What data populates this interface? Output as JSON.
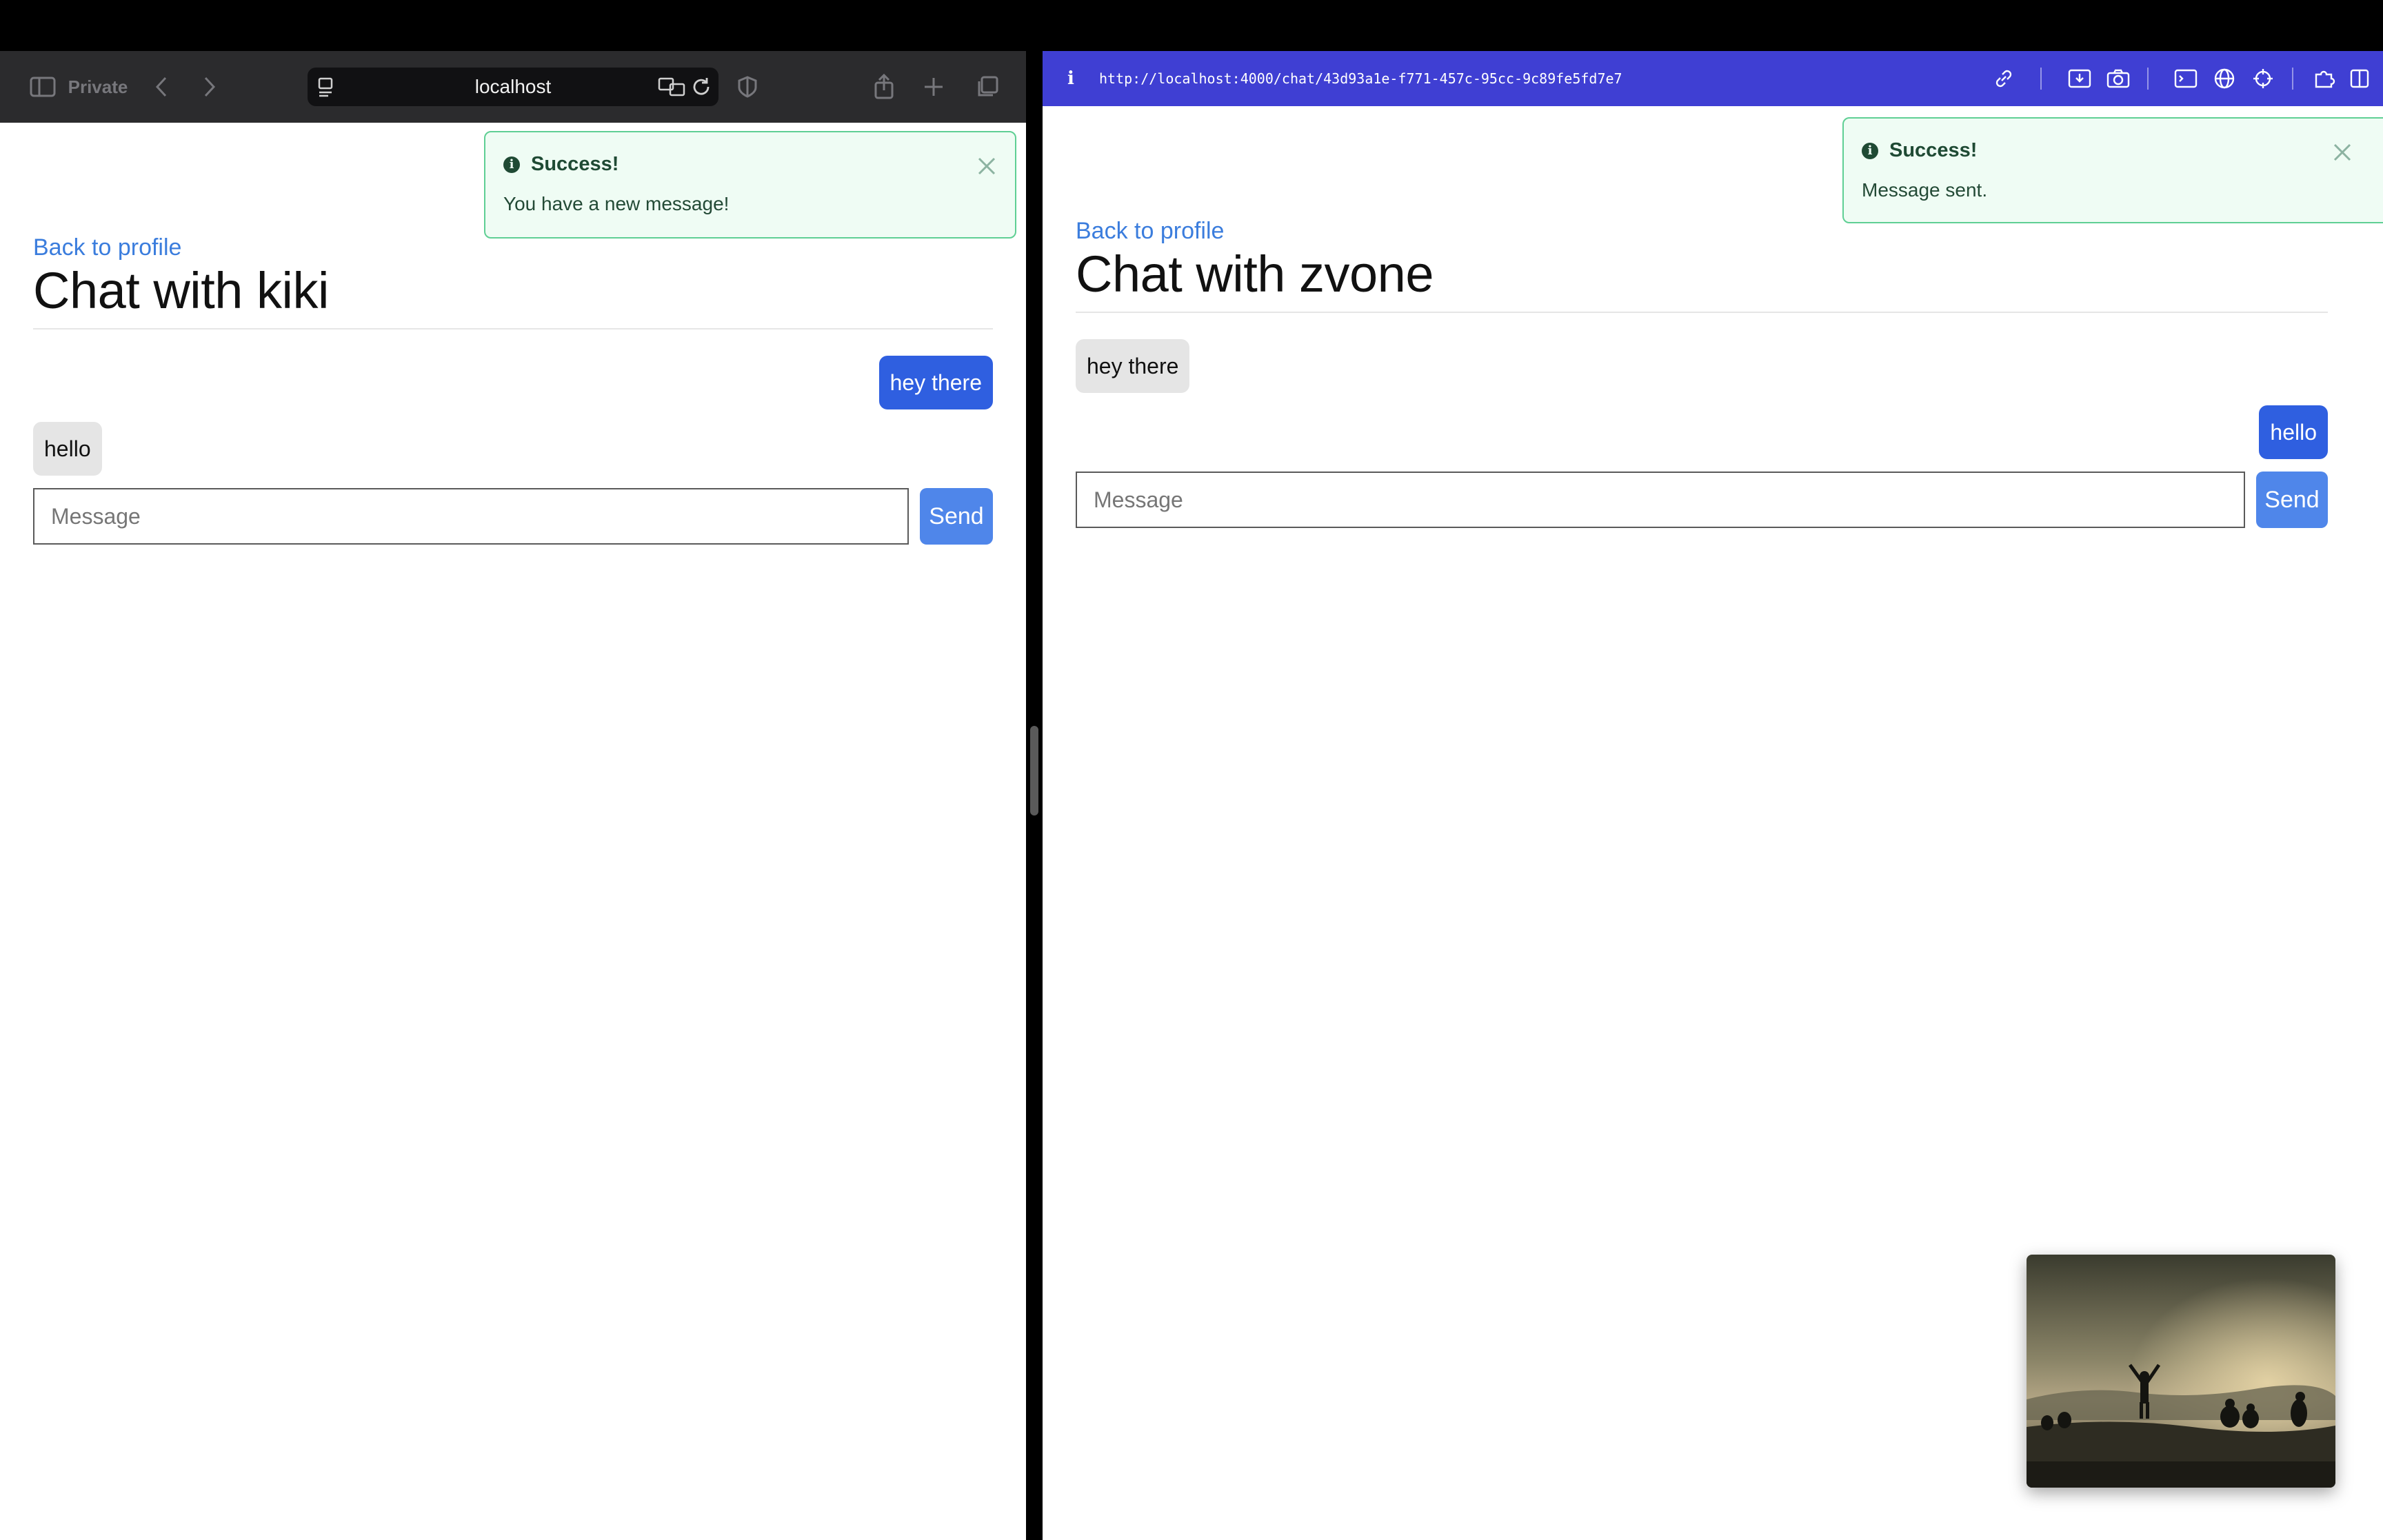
{
  "left_window": {
    "toolbar": {
      "private_label": "Private",
      "address_host": "localhost"
    },
    "toast": {
      "title": "Success!",
      "message": "You have a new message!"
    },
    "back_link": "Back to profile",
    "title": "Chat with kiki",
    "messages": [
      {
        "text": "hey there",
        "from": "me"
      },
      {
        "text": "hello",
        "from": "other"
      }
    ],
    "input": {
      "placeholder": "Message",
      "value": ""
    },
    "send_label": "Send"
  },
  "right_window": {
    "toolbar": {
      "info_glyph": "i",
      "url": "http://localhost:4000/chat/43d93a1e-f771-457c-95cc-9c89fe5fd7e7"
    },
    "toast": {
      "title": "Success!",
      "message": "Message sent."
    },
    "back_link": "Back to profile",
    "title": "Chat with zvone",
    "messages": [
      {
        "text": "hey there",
        "from": "other"
      },
      {
        "text": "hello",
        "from": "me"
      }
    ],
    "input": {
      "placeholder": "Message",
      "value": ""
    },
    "send_label": "Send"
  },
  "colors": {
    "my_bubble": "#2f5fe0",
    "their_bubble": "#e5e5e5",
    "link": "#3b7ddd",
    "send_button": "#4f86ea",
    "success_bg": "#effcf4",
    "success_border": "#5fcf94",
    "dev_bar": "#3f3fd3"
  }
}
